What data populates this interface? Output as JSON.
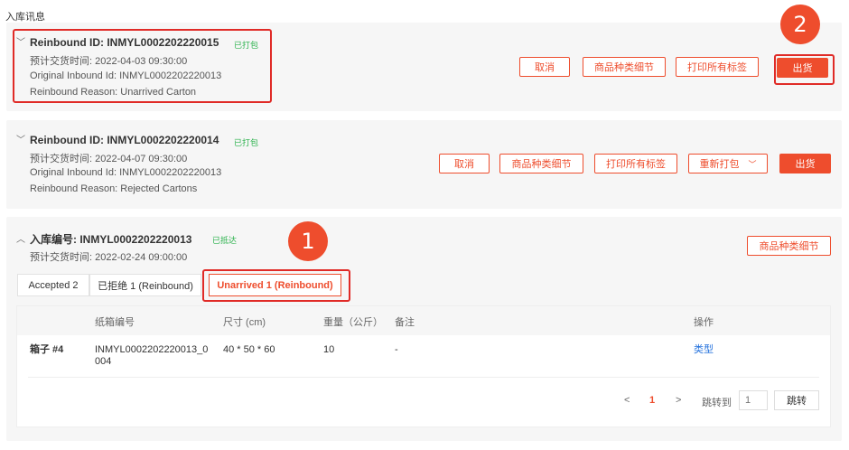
{
  "page": {
    "title": "入库讯息"
  },
  "markers": {
    "step1": "1",
    "step2": "2"
  },
  "cards": [
    {
      "title": "Reinbound ID: INMYL0002202220015",
      "status": "已打包",
      "ship_time": "预计交货时间: 2022-04-03 09:30:00",
      "original_id": "Original Inbound Id: INMYL0002202220013",
      "reason": "Reinbound Reason: Unarrived Carton",
      "buttons": {
        "cancel": "取消",
        "sku_detail": "商品种类细节",
        "print_all": "打印所有标签",
        "ship": "出货"
      }
    },
    {
      "title": "Reinbound ID: INMYL0002202220014",
      "status": "已打包",
      "ship_time": "预计交货时间: 2022-04-07 09:30:00",
      "original_id": "Original Inbound Id: INMYL0002202220013",
      "reason": "Reinbound Reason: Rejected Cartons",
      "buttons": {
        "cancel": "取消",
        "sku_detail": "商品种类细节",
        "print_all": "打印所有标签",
        "repack": "重新打包",
        "ship": "出货"
      }
    },
    {
      "title": "入库编号: INMYL0002202220013",
      "status": "已抵达",
      "ship_time": "预计交货时间: 2022-02-24 09:00:00",
      "buttons": {
        "sku_detail": "商品种类细节"
      },
      "tabs": [
        "Accepted 2",
        "已拒绝 1 (Reinbound)",
        "Unarrived 1 (Reinbound)"
      ],
      "table": {
        "headers": [
          "纸箱编号",
          "尺寸 (cm)",
          "重量（公斤）",
          "备注",
          "操作"
        ],
        "rows": [
          {
            "box": "箱子 #4",
            "carton_line1": "INMYL0002202220013_0",
            "carton_line2": "004",
            "size": "40 * 50 * 60",
            "weight": "10",
            "note": "-",
            "action": "类型"
          }
        ]
      },
      "pagination": {
        "prev": "<",
        "current": "1",
        "next": ">",
        "jump_label": "跳转到",
        "jump_placeholder": "1",
        "jump_button": "跳转"
      }
    }
  ],
  "colors": {
    "accent": "#ee4d2d",
    "status_green": "#2bb24c",
    "link": "#2673dd",
    "highlight": "#e02b27"
  }
}
